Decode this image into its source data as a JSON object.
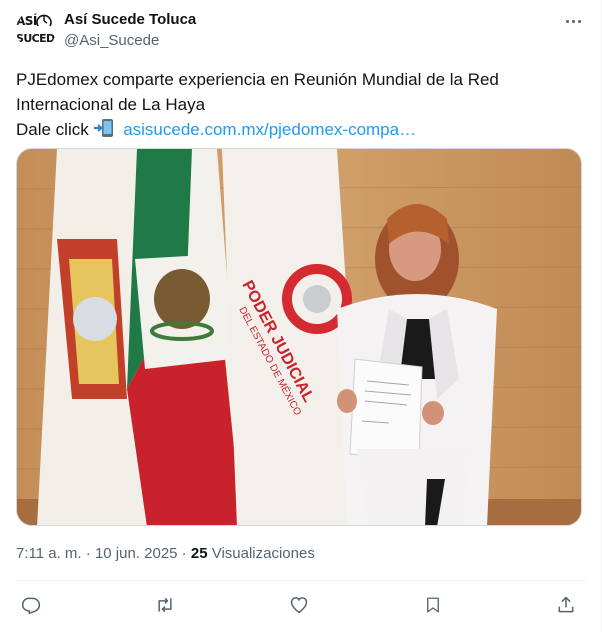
{
  "account": {
    "avatar_line1": "ASÍ",
    "avatar_line2": "SUCEDE",
    "name": "Así Sucede Toluca",
    "handle": "@Asi_Sucede"
  },
  "tweet": {
    "line1": "PJEdomex comparte experiencia en Reunión Mundial de la Red",
    "line2": "Internacional de La Haya",
    "line3_prefix": "Dale click ",
    "link_text": "asisucede.com.mx/pjedomex-compa…"
  },
  "media": {
    "banner_text_line1": "PODER JUDICIAL",
    "banner_text_line2": "DEL ESTADO DE MÉXICO"
  },
  "meta": {
    "time": "7:11 a. m.",
    "sep1": " · ",
    "date": "10 jun. 2025",
    "sep2": " · ",
    "views_count": "25",
    "views_label": " Visualizaciones"
  },
  "icons": {
    "reply": "reply-icon",
    "retweet": "retweet-icon",
    "like": "like-icon",
    "bookmark": "bookmark-icon",
    "share": "share-icon",
    "more": "more-icon",
    "phone": "mobile-phone-arrow-icon"
  },
  "colors": {
    "link": "#1d9bf0",
    "secondary_text": "#536471",
    "primary_text": "#0f1419"
  }
}
